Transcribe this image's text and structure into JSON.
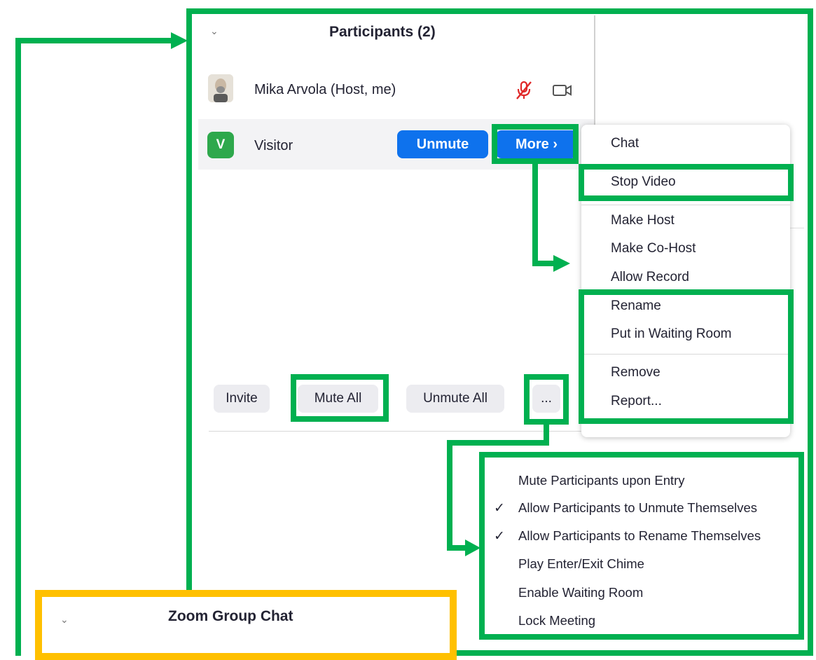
{
  "participants_panel": {
    "title": "Participants (2)",
    "collapse_icon": "chevron-down-icon",
    "participants": [
      {
        "name": "Mika Arvola (Host, me)",
        "avatar": "photo",
        "audio_icon": "microphone-muted-icon",
        "video_icon": "video-camera-icon"
      },
      {
        "name": "Visitor",
        "avatar_letter": "V",
        "avatar_color": "#2ea84c",
        "unmute_label": "Unmute",
        "more_label": "More ›"
      }
    ],
    "footer": {
      "invite_label": "Invite",
      "mute_all_label": "Mute All",
      "unmute_all_label": "Unmute All",
      "more_label": "..."
    }
  },
  "participant_menu": {
    "items": [
      "Chat",
      "Stop Video",
      "Make Host",
      "Make Co-Host",
      "Allow Record",
      "Rename",
      "Put in Waiting Room",
      "Remove",
      "Report..."
    ]
  },
  "settings_menu": {
    "items": [
      {
        "label": "Mute Participants upon Entry",
        "checked": false
      },
      {
        "label": "Allow Participants to Unmute Themselves",
        "checked": true
      },
      {
        "label": "Allow Participants to Rename Themselves",
        "checked": true
      },
      {
        "label": "Play Enter/Exit Chime",
        "checked": false
      },
      {
        "label": "Enable Waiting Room",
        "checked": false
      },
      {
        "label": "Lock Meeting",
        "checked": false
      }
    ],
    "check_glyph": "✓"
  },
  "group_chat": {
    "title": "Zoom Group Chat",
    "collapse_icon": "chevron-down-icon"
  },
  "colors": {
    "annotation_green": "#00b050",
    "annotation_yellow": "#ffc000",
    "zoom_blue": "#0e72ed"
  }
}
